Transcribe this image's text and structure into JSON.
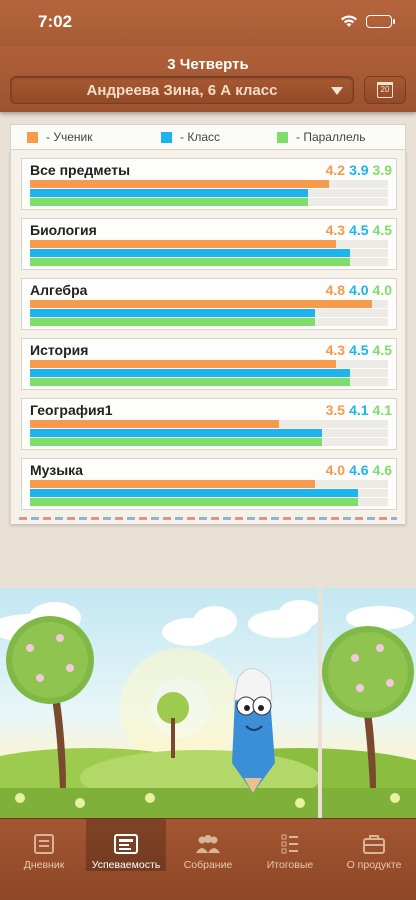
{
  "status": {
    "time": "7:02"
  },
  "header": {
    "title": "3 Четверть",
    "student": "Андреева Зина, 6 А класс",
    "calendar_day": "20"
  },
  "legend": {
    "student": "- Ученик",
    "class": "- Класс",
    "parallel": "- Параллель"
  },
  "colors": {
    "student": "#f79a4c",
    "class": "#1bb4ec",
    "parallel": "#7fdd6b"
  },
  "subjects": [
    {
      "name": "Все предметы",
      "student": "4.2",
      "class": "3.9",
      "parallel": "3.9",
      "student_frac": 0.84,
      "class_frac": 0.78,
      "parallel_frac": 0.78
    },
    {
      "name": "Биология",
      "student": "4.3",
      "class": "4.5",
      "parallel": "4.5",
      "student_frac": 0.86,
      "class_frac": 0.9,
      "parallel_frac": 0.9
    },
    {
      "name": "Алгебра",
      "student": "4.8",
      "class": "4.0",
      "parallel": "4.0",
      "student_frac": 0.96,
      "class_frac": 0.8,
      "parallel_frac": 0.8
    },
    {
      "name": "История",
      "student": "4.3",
      "class": "4.5",
      "parallel": "4.5",
      "student_frac": 0.86,
      "class_frac": 0.9,
      "parallel_frac": 0.9
    },
    {
      "name": "География1",
      "student": "3.5",
      "class": "4.1",
      "parallel": "4.1",
      "student_frac": 0.7,
      "class_frac": 0.82,
      "parallel_frac": 0.82
    },
    {
      "name": "Музыка",
      "student": "4.0",
      "class": "4.6",
      "parallel": "4.6",
      "student_frac": 0.8,
      "class_frac": 0.92,
      "parallel_frac": 0.92
    }
  ],
  "tabs": [
    {
      "label": "Дневник",
      "icon": "diary-icon",
      "active": false
    },
    {
      "label": "Успеваемость",
      "icon": "performance-icon",
      "active": true
    },
    {
      "label": "Собрание",
      "icon": "meeting-icon",
      "active": false
    },
    {
      "label": "Итоговые",
      "icon": "totals-icon",
      "active": false
    },
    {
      "label": "О продукте",
      "icon": "briefcase-icon",
      "active": false
    }
  ]
}
